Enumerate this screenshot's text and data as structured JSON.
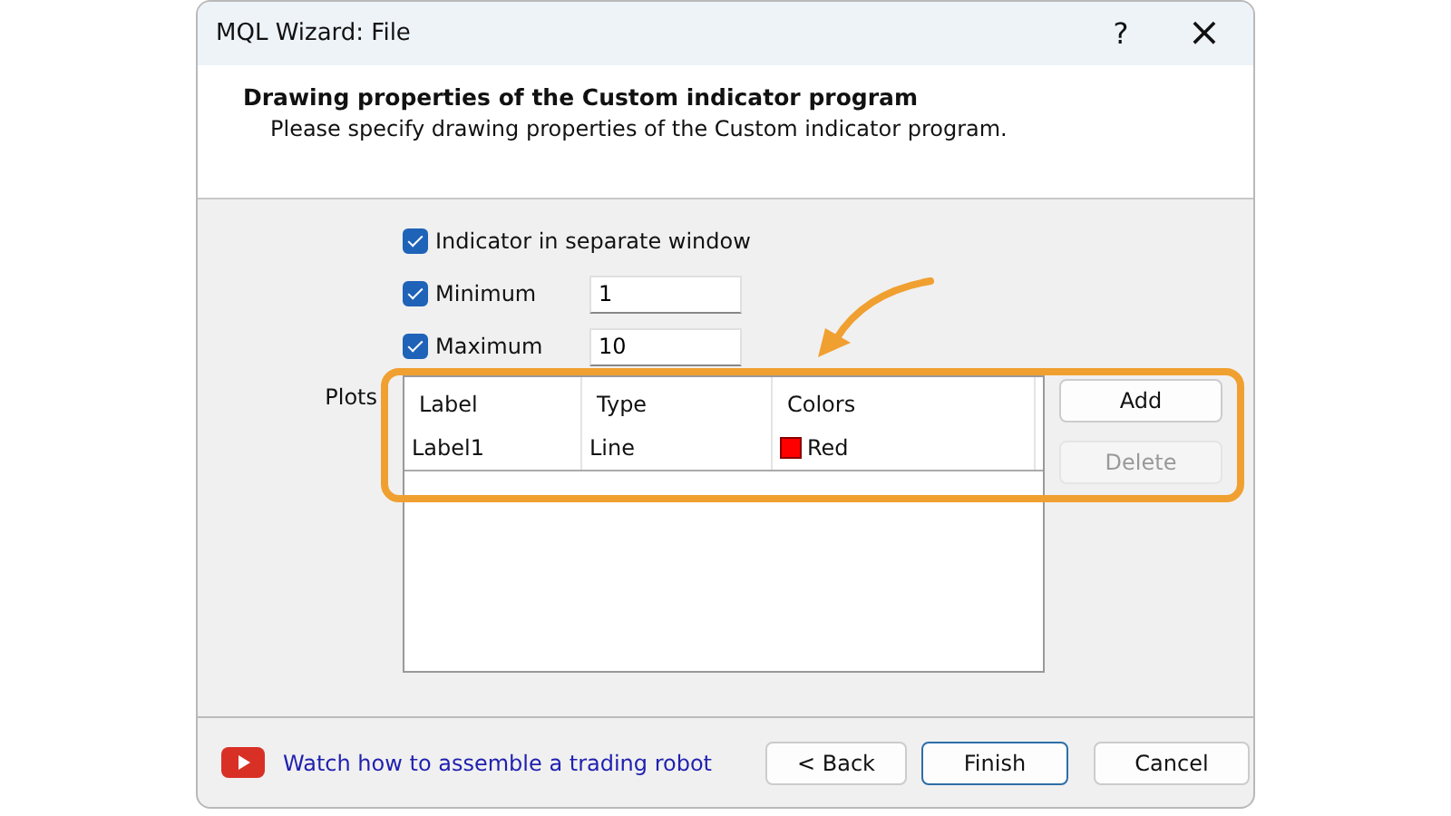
{
  "window": {
    "title": "MQL Wizard: File",
    "help": "?",
    "close": "×"
  },
  "header": {
    "title": "Drawing properties of the Custom indicator program",
    "subtitle": "Please specify drawing properties of the Custom indicator program."
  },
  "options": [
    {
      "kind": "check",
      "label": "Indicator in separate window",
      "checked": true
    },
    {
      "kind": "field",
      "label": "Minimum",
      "checked": true,
      "value": "1"
    },
    {
      "kind": "field",
      "label": "Maximum",
      "checked": true,
      "value": "10"
    }
  ],
  "plots": {
    "label": "Plots",
    "columns": [
      "Label",
      "Type",
      "Colors"
    ],
    "rows": [
      {
        "label": "Label1",
        "type": "Line",
        "color_name": "Red",
        "color": "#ff0000"
      }
    ],
    "buttons": [
      {
        "label": "Add",
        "disabled": false
      },
      {
        "label": "Delete",
        "disabled": true
      }
    ]
  },
  "annotation": {
    "highlight": true
  },
  "footer": {
    "link": "Watch how to assemble a trading robot",
    "buttons": [
      {
        "label": "< Back",
        "default": false
      },
      {
        "label": "Finish",
        "default": true
      },
      {
        "label": "Cancel",
        "default": false
      }
    ]
  }
}
